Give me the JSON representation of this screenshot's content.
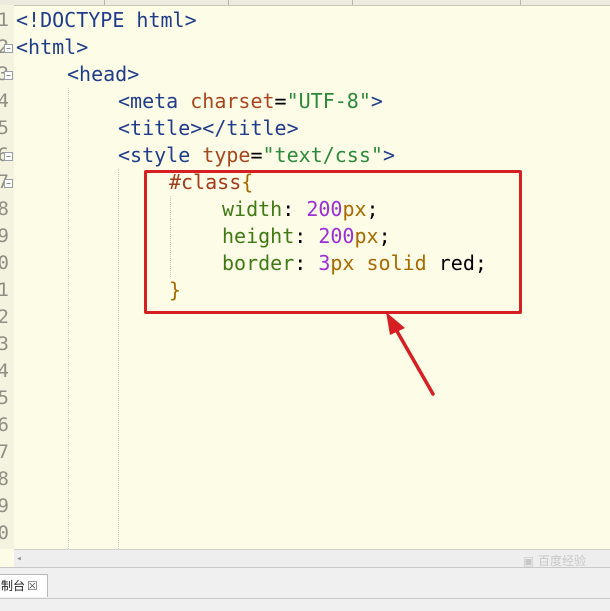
{
  "editor": {
    "line_numbers": [
      "1",
      "2",
      "3",
      "4",
      "5",
      "6",
      "7",
      "8",
      "9",
      "0",
      "1",
      "2",
      "3",
      "4",
      "5",
      "6",
      "7",
      "8",
      "9",
      "0"
    ],
    "lines": [
      [
        {
          "t": "<!DOCTYPE html>",
          "c": "tag"
        }
      ],
      [
        {
          "t": "<html>",
          "c": "tag"
        }
      ],
      [
        {
          "t": "<head>",
          "c": "tag"
        }
      ],
      [
        {
          "t": "<meta ",
          "c": "tag"
        },
        {
          "t": "charset",
          "c": "attr"
        },
        {
          "t": "=",
          "c": "txt"
        },
        {
          "t": "\"UTF-8\"",
          "c": "str"
        },
        {
          "t": ">",
          "c": "tag"
        }
      ],
      [
        {
          "t": "<title></title>",
          "c": "tag"
        }
      ],
      [
        {
          "t": "<style ",
          "c": "tag"
        },
        {
          "t": "type",
          "c": "attr"
        },
        {
          "t": "=",
          "c": "txt"
        },
        {
          "t": "\"text/css\"",
          "c": "str"
        },
        {
          "t": ">",
          "c": "tag"
        }
      ],
      [
        {
          "t": "#class",
          "c": "sel"
        },
        {
          "t": "{",
          "c": "kw"
        }
      ],
      [
        {
          "t": "width",
          "c": "prop"
        },
        {
          "t": ": ",
          "c": "txt"
        },
        {
          "t": "200",
          "c": "num"
        },
        {
          "t": "px",
          "c": "kw"
        },
        {
          "t": ";",
          "c": "txt"
        }
      ],
      [
        {
          "t": "height",
          "c": "prop"
        },
        {
          "t": ": ",
          "c": "txt"
        },
        {
          "t": "200",
          "c": "num"
        },
        {
          "t": "px",
          "c": "kw"
        },
        {
          "t": ";",
          "c": "txt"
        }
      ],
      [
        {
          "t": "border",
          "c": "prop"
        },
        {
          "t": ": ",
          "c": "txt"
        },
        {
          "t": "3",
          "c": "num"
        },
        {
          "t": "px ",
          "c": "kw"
        },
        {
          "t": "solid ",
          "c": "kw"
        },
        {
          "t": "red",
          "c": "txt"
        },
        {
          "t": ";",
          "c": "txt"
        }
      ],
      [
        {
          "t": "}",
          "c": "kw"
        }
      ]
    ]
  },
  "watermark": "▣ 百度经验",
  "console_tab": {
    "label": "制台",
    "close": "☒"
  },
  "highlight_color": "#d51f22"
}
